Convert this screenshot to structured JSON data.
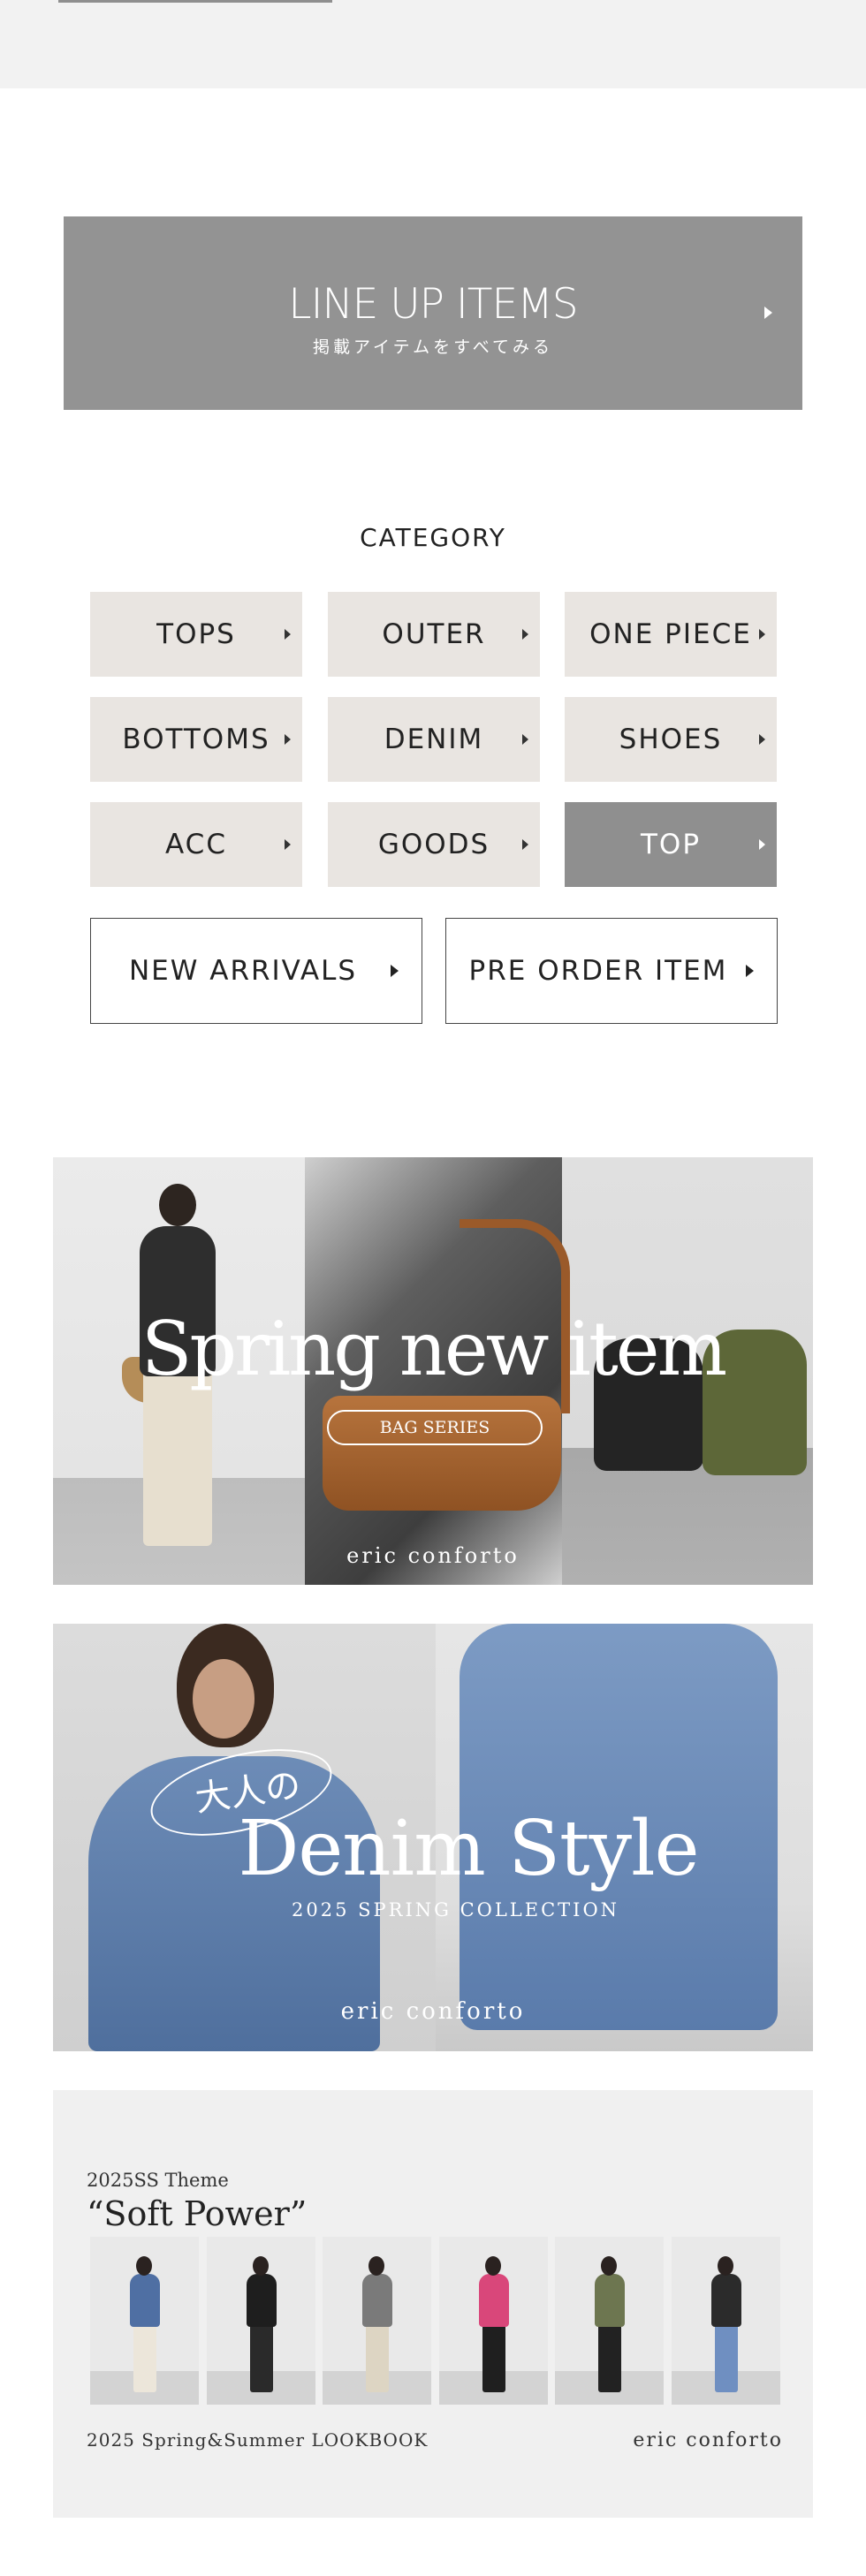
{
  "lineup": {
    "title": "LINE UP ITEMS",
    "subtitle": "掲載アイテムをすべてみる"
  },
  "category": {
    "heading": "CATEGORY",
    "items": [
      {
        "label": "TOPS",
        "active": false
      },
      {
        "label": "OUTER",
        "active": false
      },
      {
        "label": "ONE PIECE",
        "active": false
      },
      {
        "label": "BOTTOMS",
        "active": false
      },
      {
        "label": "DENIM",
        "active": false
      },
      {
        "label": "SHOES",
        "active": false
      },
      {
        "label": "ACC",
        "active": false
      },
      {
        "label": "GOODS",
        "active": false
      },
      {
        "label": "TOP",
        "active": true
      }
    ],
    "outline_buttons": [
      {
        "label": "NEW ARRIVALS"
      },
      {
        "label": "PRE ORDER ITEM"
      }
    ]
  },
  "banners": {
    "spring": {
      "headline": "Spring new item",
      "tag": "BAG SERIES",
      "brand": "eric conforto"
    },
    "denim": {
      "tagline": "大人の",
      "headline": "Denim Style",
      "subline": "2025 SPRING COLLECTION",
      "brand": "eric conforto"
    },
    "lookbook": {
      "theme": "2025SS Theme",
      "title": "“Soft Power”",
      "footer": "2025 Spring&Summer LOOKBOOK",
      "brand": "eric conforto",
      "looks": [
        {
          "top": "#4f6fa3",
          "bottom": "#ece6da"
        },
        {
          "top": "#1e1e1e",
          "bottom": "#2a2a2a"
        },
        {
          "top": "#7a7a7a",
          "bottom": "#ddd5c3"
        },
        {
          "top": "#d9477a",
          "bottom": "#1f1f1f"
        },
        {
          "top": "#6d7650",
          "bottom": "#222222"
        },
        {
          "top": "#2b2b2b",
          "bottom": "#6f8fc1"
        }
      ]
    }
  },
  "colors": {
    "category_bg": "#e9e5e1",
    "active_bg": "#8f8f8f",
    "lineup_bg": "#939393"
  }
}
